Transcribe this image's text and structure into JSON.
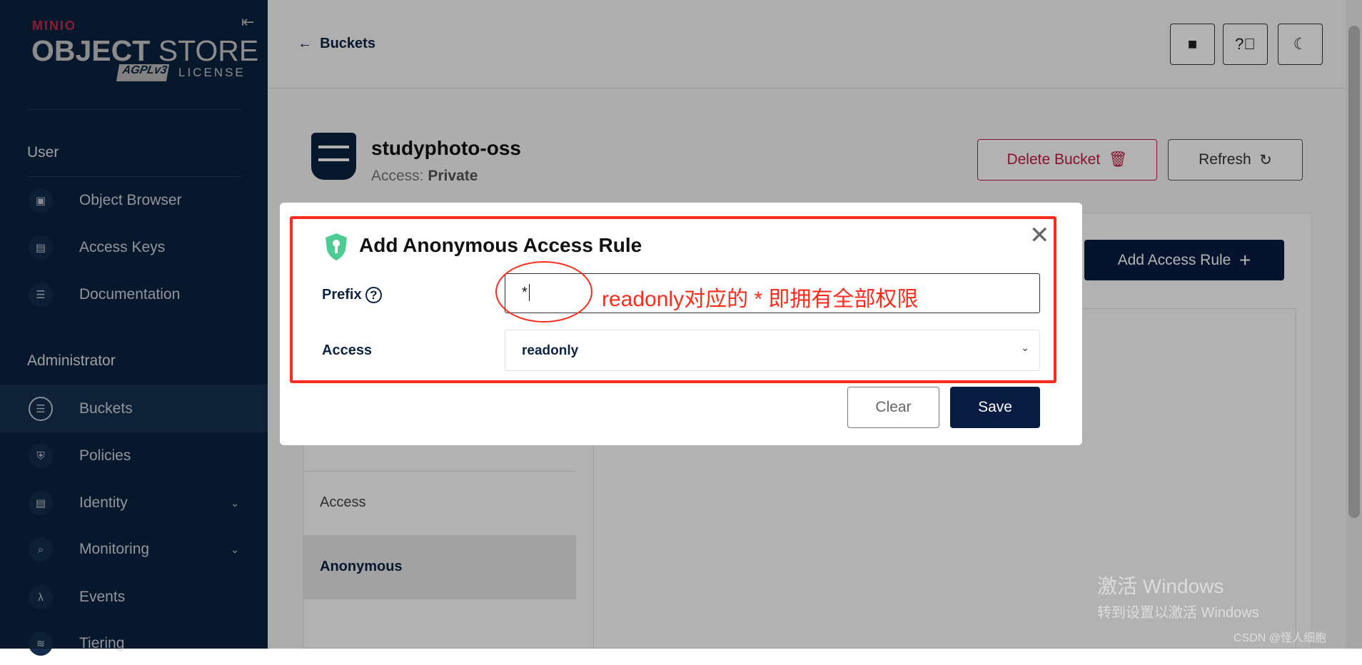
{
  "sidebar": {
    "logo": {
      "brand": "MINIO",
      "product_bold": "OBJECT",
      "product_light": "STORE",
      "agpl": "AGPLv3",
      "license": "LICENSE"
    },
    "sections": [
      {
        "title": "User",
        "items": [
          {
            "label": "Object Browser",
            "icon": "object-browser-icon"
          },
          {
            "label": "Access Keys",
            "icon": "key-card-icon"
          },
          {
            "label": "Documentation",
            "icon": "document-icon"
          }
        ]
      },
      {
        "title": "Administrator",
        "items": [
          {
            "label": "Buckets",
            "icon": "bucket-icon",
            "active": true
          },
          {
            "label": "Policies",
            "icon": "shield-icon"
          },
          {
            "label": "Identity",
            "icon": "id-card-icon",
            "expandable": true
          },
          {
            "label": "Monitoring",
            "icon": "magnifier-icon",
            "expandable": true
          },
          {
            "label": "Events",
            "icon": "lambda-icon"
          },
          {
            "label": "Tiering",
            "icon": "layers-icon"
          }
        ]
      }
    ]
  },
  "header": {
    "back_label": "Buckets",
    "buttons": [
      "folder-icon",
      "help-icon",
      "dark-mode-icon"
    ]
  },
  "bucket": {
    "name": "studyphoto-oss",
    "access_label": "Access:",
    "access_value": "Private",
    "delete_label": "Delete Bucket",
    "refresh_label": "Refresh"
  },
  "panel": {
    "add_rule_label": "Add Access Rule",
    "tabs": [
      {
        "label": "Access"
      },
      {
        "label": "Anonymous",
        "active": true
      }
    ]
  },
  "modal": {
    "title": "Add Anonymous Access Rule",
    "prefix_label": "Prefix",
    "prefix_value": "*",
    "access_label": "Access",
    "access_value": "readonly",
    "clear_label": "Clear",
    "save_label": "Save",
    "annotation": "readonly对应的 * 即拥有全部权限"
  },
  "watermark": {
    "line1": "激活 Windows",
    "line2": "转到设置以激活 Windows",
    "csdn": "CSDN @怪人细胞"
  },
  "colors": {
    "sidebar": "#0c2340",
    "primary": "#081c42",
    "danger": "#c51b3f",
    "annotation": "#ff2a1a",
    "shield": "#4ccb92"
  }
}
